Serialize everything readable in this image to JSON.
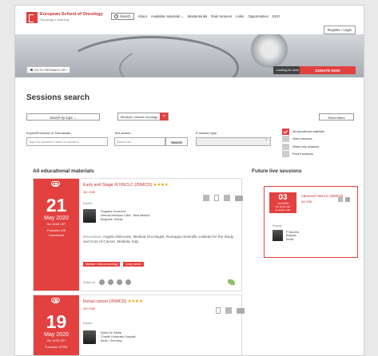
{
  "brand": {
    "title": "European School of Oncology",
    "subtitle": "Oncology e-learning"
  },
  "nav": {
    "items": [
      "Search",
      "About",
      "Available materials ⌄",
      "Masterminds",
      "Rare tumours",
      "Links",
      "Opportunities",
      "ESO"
    ]
  },
  "header": {
    "login_label": "Register / Login"
  },
  "hero": {
    "back_label": "GO TO PATHWAYS LIST",
    "alt_label": "Looking for work",
    "donate_label": "DONATE NOW"
  },
  "search": {
    "title": "Sessions search",
    "by_topic_label": "Search by topic ⌄",
    "topic_tag": "Medical / clinical oncology",
    "reset_label": "Reset filters",
    "expert_label": "Expert/Presenter or Discussant",
    "expert_placeholder": "Type the speaker's name or surname",
    "text_label": "Text search",
    "text_placeholder": "Search for...",
    "search_button": "Search",
    "type_label": "E-session type",
    "filters": [
      "All educational materials",
      "Video sessions",
      "Slides only sessions",
      "Future sessions"
    ]
  },
  "sections": {
    "all_title": "All educational materials",
    "future_title": "Future live sessions"
  },
  "cards": [
    {
      "day": "21",
      "month": "May 2020",
      "time": "Oct 15:00 CET",
      "session": "E-session 128",
      "format": "Grandround",
      "title": "Early and Stage III NSCLC (20MCD)",
      "stars": "★★★★",
      "cme": "NO CME",
      "expert_label": "Expert:",
      "person": [
        "Dragana Jovanovic",
        "Internal Medicine Clinic \"Akta Medica\"",
        "Belgrade, Serbia"
      ],
      "discussant_key": "Discussant:",
      "discussant": "Angelo Delmonte, Medical Oncologist, Romagna Scientific Institute for the Study and Cure of Cancer, Meldola, Italy",
      "tags": [
        "Medical / clinical oncology",
        "Lung cancer"
      ],
      "share_label": "Share on:"
    },
    {
      "day": "19",
      "month": "May 2020",
      "time": "Oct 15:00 CET",
      "session": "E-session 127/50",
      "title": "Renal cancer (20MCD)",
      "stars": "★★★★",
      "cme": "NO CME",
      "expert_label": "Expert:",
      "person": [
        "Maria De Santis",
        "Charité University Hospital",
        "Berlin, Germany"
      ]
    }
  ],
  "future": {
    "day": "03",
    "month": "Jun 2020",
    "time": "Oct 18:00 CET",
    "session": "E-session 129",
    "title": "Advanced NSCLC (20MCD)",
    "cme": "NO CME",
    "expert_label": "Experts:",
    "person": [
      "P. Baronesi",
      "Belgrade",
      "Serbia"
    ]
  },
  "colors": {
    "accent": "#e2413f",
    "star": "#f0a500"
  }
}
